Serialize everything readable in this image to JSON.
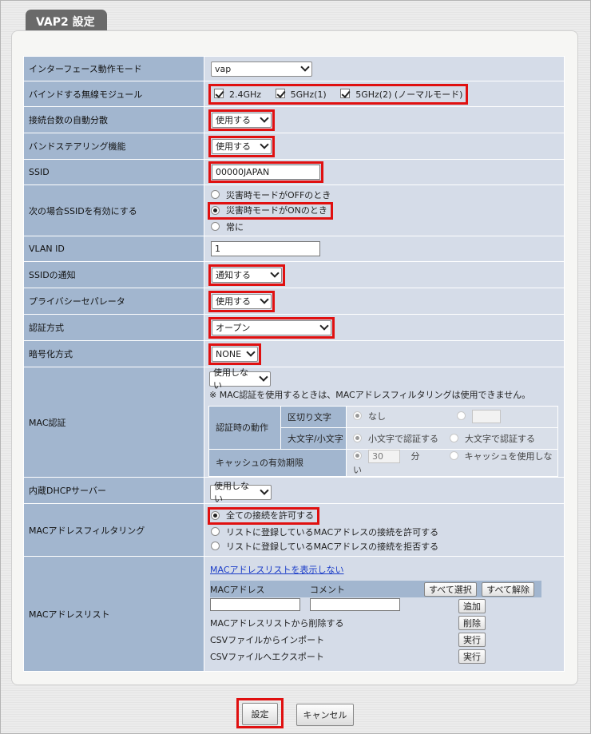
{
  "page_title": "VAP2 設定",
  "rows": {
    "interface_mode": {
      "label": "インターフェース動作モード",
      "value": "vap"
    },
    "wireless_module": {
      "label": "バインドする無線モジュール",
      "opt1": "2.4GHz",
      "opt2": "5GHz(1)",
      "opt3": "5GHz(2) (ノーマルモード)"
    },
    "auto_distribute": {
      "label": "接続台数の自動分散",
      "value": "使用する"
    },
    "band_steering": {
      "label": "バンドステアリング機能",
      "value": "使用する"
    },
    "ssid": {
      "label": "SSID",
      "value": "00000JAPAN"
    },
    "ssid_enable": {
      "label": "次の場合SSIDを有効にする",
      "opt1": "災害時モードがOFFのとき",
      "opt2": "災害時モードがONのとき",
      "opt3": "常に",
      "selected": "災害時モードがONのとき"
    },
    "vlan": {
      "label": "VLAN ID",
      "value": "1"
    },
    "ssid_notify": {
      "label": "SSIDの通知",
      "value": "通知する"
    },
    "privacy_sep": {
      "label": "プライバシーセパレータ",
      "value": "使用する"
    },
    "auth": {
      "label": "認証方式",
      "value": "オープン"
    },
    "encryption": {
      "label": "暗号化方式",
      "value": "NONE"
    },
    "mac_auth": {
      "label": "MAC認証",
      "value": "使用しない",
      "note": "※ MAC認証を使用するときは、MACアドレスフィルタリングは使用できません。",
      "action_label": "認証時の動作",
      "delimiter_label": "区切り文字",
      "delimiter_none": "なし",
      "case_label": "大文字/小文字",
      "case_lower": "小文字で認証する",
      "case_upper": "大文字で認証する",
      "cache_label": "キャッシュの有効期限",
      "cache_value": "30",
      "cache_unit": "分",
      "cache_off": "キャッシュを使用しない"
    },
    "dhcp": {
      "label": "内蔵DHCPサーバー",
      "value": "使用しない"
    },
    "mac_filter": {
      "label": "MACアドレスフィルタリング",
      "opt1": "全ての接続を許可する",
      "opt2": "リストに登録しているMACアドレスの接続を許可する",
      "opt3": "リストに登録しているMACアドレスの接続を拒否する",
      "selected": "全ての接続を許可する"
    },
    "mac_list": {
      "label": "MACアドレスリスト",
      "hide_link": "MACアドレスリストを表示しない",
      "col_mac": "MACアドレス",
      "col_comment": "コメント",
      "select_all": "すべて選択",
      "deselect_all": "すべて解除",
      "add": "追加",
      "delete_label": "MACアドレスリストから削除する",
      "delete": "削除",
      "import_label": "CSVファイルからインポート",
      "import": "実行",
      "export_label": "CSVファイルへエクスポート",
      "export": "実行"
    }
  },
  "buttons": {
    "submit": "設定",
    "cancel": "キャンセル"
  },
  "colors": {
    "label_bg": "#a2b6cf",
    "value_bg": "#d5dce8",
    "highlight": "#e01010",
    "tab_bg": "#6a6a6a"
  }
}
